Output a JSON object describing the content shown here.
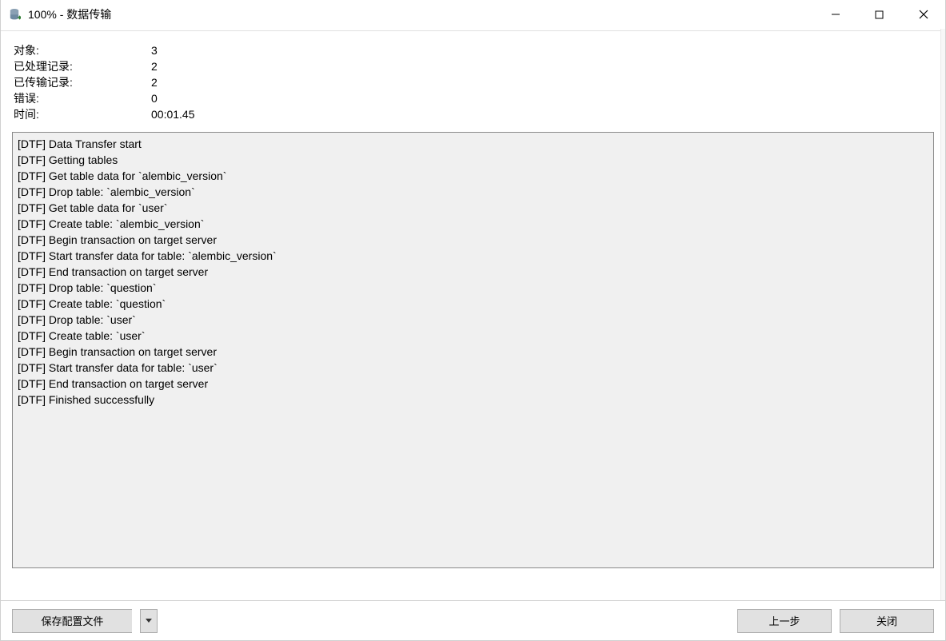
{
  "titlebar": {
    "title": "100% - 数据传输"
  },
  "stats": {
    "objects_label": "对象:",
    "objects_value": "3",
    "processed_label": "已处理记录:",
    "processed_value": "2",
    "transferred_label": "已传输记录:",
    "transferred_value": "2",
    "errors_label": "错误:",
    "errors_value": "0",
    "time_label": "时间:",
    "time_value": "00:01.45"
  },
  "log_lines": [
    "[DTF] Data Transfer start",
    "[DTF] Getting tables",
    "[DTF] Get table data for `alembic_version`",
    "[DTF] Drop table: `alembic_version`",
    "[DTF] Get table data for `user`",
    "[DTF] Create table: `alembic_version`",
    "[DTF] Begin transaction on target server",
    "[DTF] Start transfer data for table: `alembic_version`",
    "[DTF] End transaction on target server",
    "[DTF] Drop table: `question`",
    "[DTF] Create table: `question`",
    "[DTF] Drop table: `user`",
    "[DTF] Create table: `user`",
    "[DTF] Begin transaction on target server",
    "[DTF] Start transfer data for table: `user`",
    "[DTF] End transaction on target server",
    "[DTF] Finished successfully"
  ],
  "footer": {
    "save_profile_label": "保存配置文件",
    "prev_label": "上一步",
    "close_label": "关闭"
  }
}
